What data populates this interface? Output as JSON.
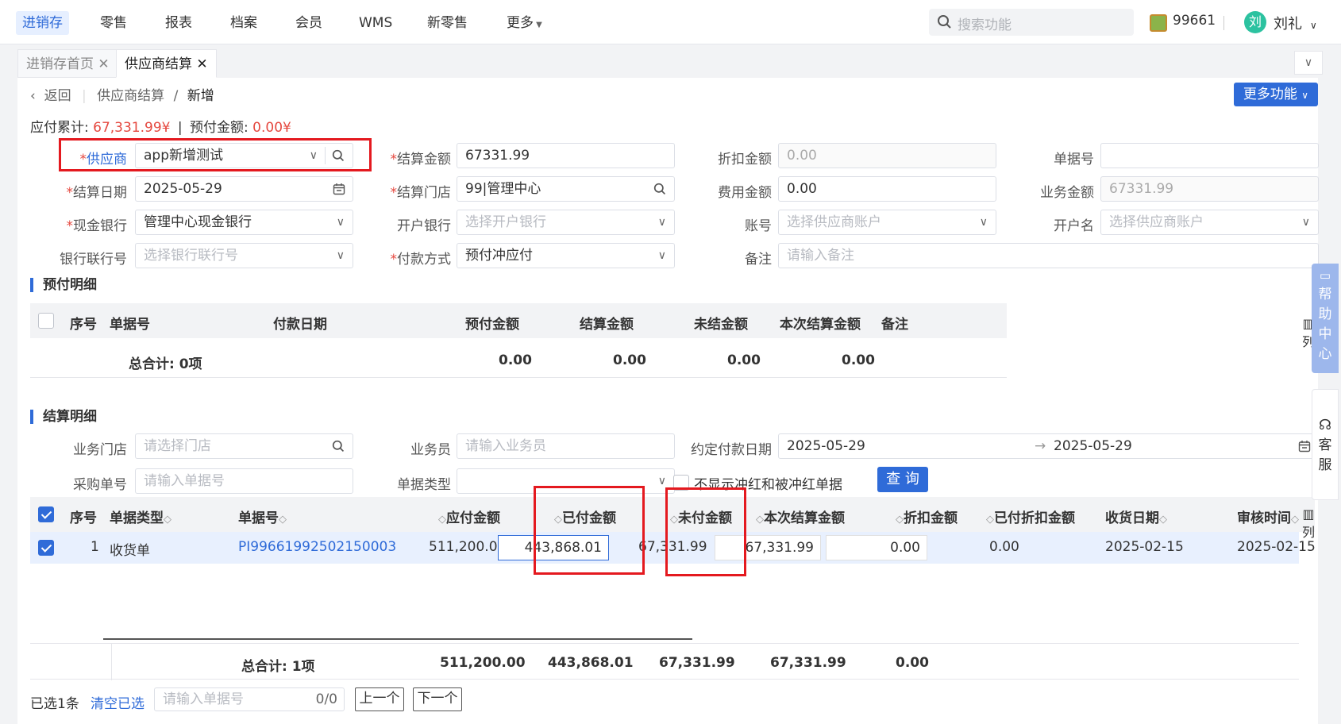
{
  "topnav": {
    "items": [
      "进销存",
      "零售",
      "报表",
      "档案",
      "会员",
      "WMS",
      "新零售",
      "更多"
    ],
    "search_placeholder": "搜索功能",
    "user_id": "99661",
    "avatar_char": "刘",
    "username": "刘礼"
  },
  "tabs": [
    {
      "label": "进销存首页"
    },
    {
      "label": "供应商结算"
    }
  ],
  "breadcrumb": {
    "back": "返回",
    "parent": "供应商结算",
    "current": "新增"
  },
  "more_button": "更多功能",
  "summary": {
    "payable_label": "应付累计:",
    "payable_value": "67,331.99¥",
    "sep": "|",
    "prepaid_label": "预付金额:",
    "prepaid_value": "0.00¥"
  },
  "form": {
    "supplier_label": "供应商",
    "supplier_value": "app新增测试",
    "settle_amount_label": "结算金额",
    "settle_amount_value": "67331.99",
    "discount_label": "折扣金额",
    "discount_value": "0.00",
    "doc_no_label": "单据号",
    "doc_no_value": "",
    "settle_date_label": "结算日期",
    "settle_date_value": "2025-05-29",
    "settle_store_label": "结算门店",
    "settle_store_value": "99|管理中心",
    "fee_label": "费用金额",
    "fee_value": "0.00",
    "biz_amount_label": "业务金额",
    "biz_amount_value": "67331.99",
    "cash_bank_label": "现金银行",
    "cash_bank_value": "管理中心现金银行",
    "open_bank_label": "开户银行",
    "open_bank_placeholder": "选择开户银行",
    "account_label": "账号",
    "account_placeholder": "选择供应商账户",
    "account_name_label": "开户名",
    "account_name_placeholder": "选择供应商账户",
    "bank_code_label": "银行联行号",
    "bank_code_placeholder": "选择银行联行号",
    "pay_method_label": "付款方式",
    "pay_method_value": "预付冲应付",
    "remark_label": "备注",
    "remark_placeholder": "请输入备注"
  },
  "prepay": {
    "title": "预付明细",
    "headers": [
      "序号",
      "单据号",
      "付款日期",
      "预付金额",
      "结算金额",
      "未结金额",
      "本次结算金额",
      "备注"
    ],
    "col_toggle": "列",
    "total_label": "总合计: 0项",
    "totals": [
      "0.00",
      "0.00",
      "0.00",
      "0.00"
    ]
  },
  "settle": {
    "title": "结算明细",
    "store_label": "业务门店",
    "store_placeholder": "请选择门店",
    "salesman_label": "业务员",
    "salesman_placeholder": "请输入业务员",
    "due_date_label": "约定付款日期",
    "due_date_from": "2025-05-29",
    "due_date_to": "2025-05-29",
    "purchase_no_label": "采购单号",
    "purchase_no_placeholder": "请输入单据号",
    "doc_type_label": "单据类型",
    "hide_red_label": "不显示冲红和被冲红单据",
    "query_button": "查 询",
    "headers": [
      "序号",
      "单据类型",
      "单据号",
      "应付金额",
      "已付金额",
      "未付金额",
      "本次结算金额",
      "折扣金额",
      "已付折扣金额",
      "收货日期",
      "审核时间"
    ],
    "col_toggle": "列",
    "row": {
      "index": "1",
      "type": "收货单",
      "doc_no": "PI99661992502150003",
      "payable": "511,200.00",
      "paid": "443,868.01",
      "unpaid": "67,331.99",
      "this_settle": "67,331.99",
      "discount": "0.00",
      "paid_discount": "0.00",
      "receive_date": "2025-02-15",
      "audit_time": "2025-02-15"
    },
    "total_label": "总合计: 1项",
    "totals": {
      "payable": "511,200.00",
      "paid": "443,868.01",
      "unpaid": "67,331.99",
      "this_settle": "67,331.99",
      "discount": "0.00"
    }
  },
  "footer": {
    "selected": "已选1条",
    "clear": "清空已选",
    "search_placeholder": "请输入单据号",
    "counter": "0/0",
    "prev": "上一个",
    "next": "下一个"
  },
  "side": {
    "help": [
      "帮",
      "助",
      "中",
      "心"
    ],
    "kefu": [
      "客",
      "服"
    ]
  }
}
